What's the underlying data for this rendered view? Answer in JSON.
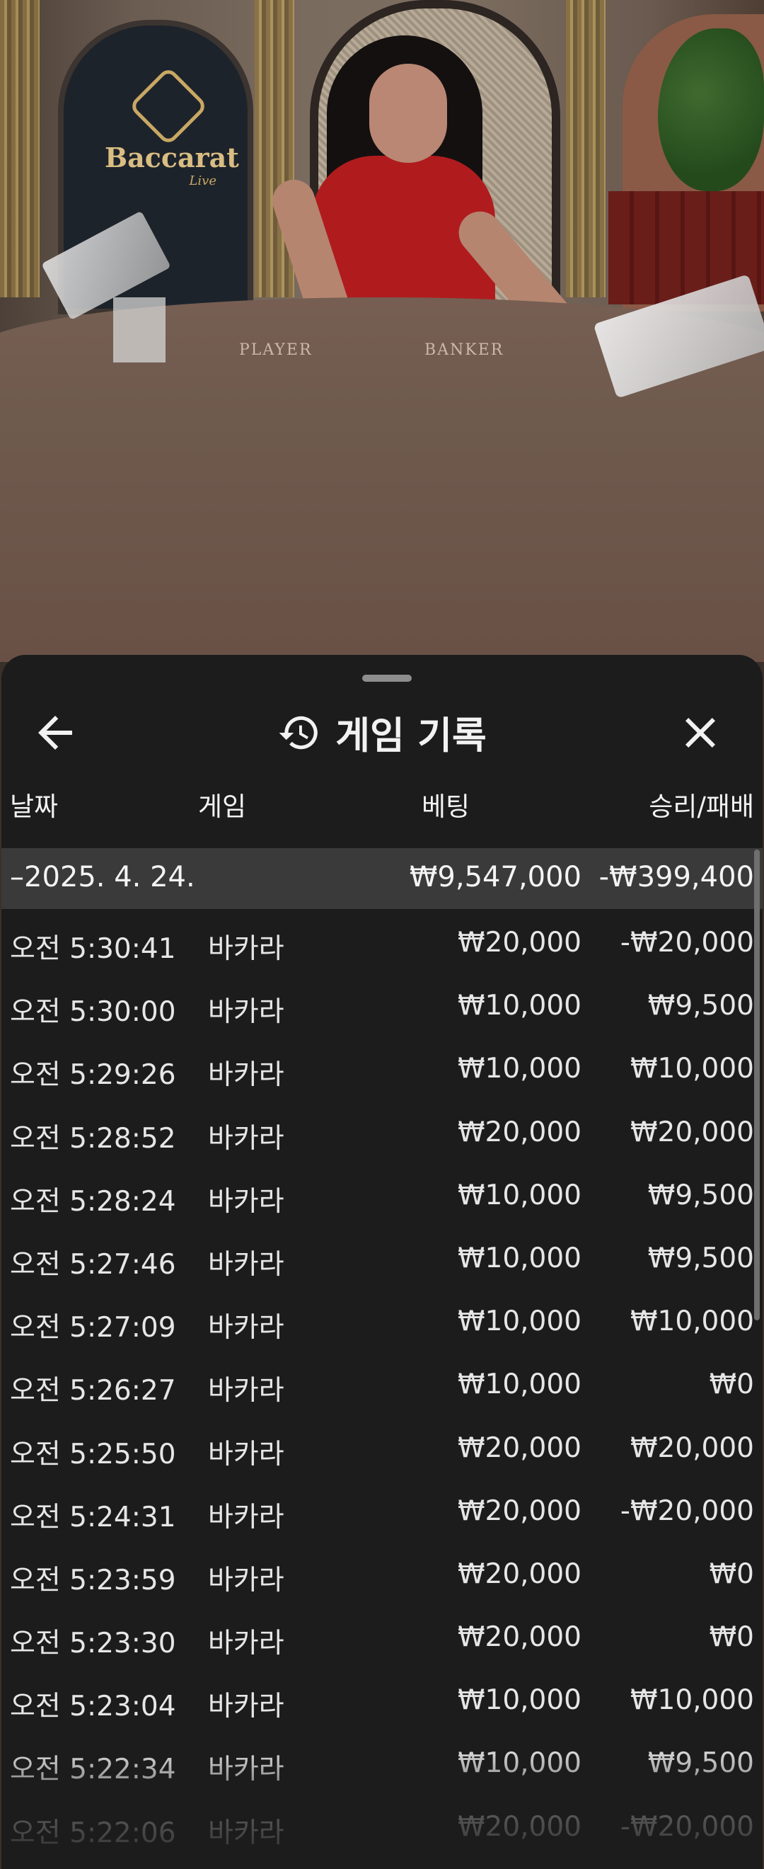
{
  "video": {
    "logo_text": "Baccarat",
    "logo_sub": "Live",
    "table_player": "PLAYER",
    "table_banker": "BANKER"
  },
  "panel": {
    "title": "게임 기록",
    "icons": {
      "back": "arrow-left-icon",
      "history": "history-clock-icon",
      "close": "close-x-icon"
    },
    "columns": {
      "date": "날짜",
      "game": "게임",
      "bet": "베팅",
      "result": "승리/패배"
    },
    "summary": {
      "date": "–2025. 4. 24.",
      "bet": "₩9,547,000",
      "result": "-₩399,400"
    },
    "rows": [
      {
        "time": "오전 5:30:41",
        "game": "바카라",
        "bet": "₩20,000",
        "result": "-₩20,000"
      },
      {
        "time": "오전 5:30:00",
        "game": "바카라",
        "bet": "₩10,000",
        "result": "₩9,500"
      },
      {
        "time": "오전 5:29:26",
        "game": "바카라",
        "bet": "₩10,000",
        "result": "₩10,000"
      },
      {
        "time": "오전 5:28:52",
        "game": "바카라",
        "bet": "₩20,000",
        "result": "₩20,000"
      },
      {
        "time": "오전 5:28:24",
        "game": "바카라",
        "bet": "₩10,000",
        "result": "₩9,500"
      },
      {
        "time": "오전 5:27:46",
        "game": "바카라",
        "bet": "₩10,000",
        "result": "₩9,500"
      },
      {
        "time": "오전 5:27:09",
        "game": "바카라",
        "bet": "₩10,000",
        "result": "₩10,000"
      },
      {
        "time": "오전 5:26:27",
        "game": "바카라",
        "bet": "₩10,000",
        "result": "₩0"
      },
      {
        "time": "오전 5:25:50",
        "game": "바카라",
        "bet": "₩20,000",
        "result": "₩20,000"
      },
      {
        "time": "오전 5:24:31",
        "game": "바카라",
        "bet": "₩20,000",
        "result": "-₩20,000"
      },
      {
        "time": "오전 5:23:59",
        "game": "바카라",
        "bet": "₩20,000",
        "result": "₩0"
      },
      {
        "time": "오전 5:23:30",
        "game": "바카라",
        "bet": "₩20,000",
        "result": "₩0"
      },
      {
        "time": "오전 5:23:04",
        "game": "바카라",
        "bet": "₩10,000",
        "result": "₩10,000"
      },
      {
        "time": "오전 5:22:34",
        "game": "바카라",
        "bet": "₩10,000",
        "result": "₩9,500"
      },
      {
        "time": "오전 5:22:06",
        "game": "바카라",
        "bet": "₩20,000",
        "result": "-₩20,000"
      }
    ]
  }
}
